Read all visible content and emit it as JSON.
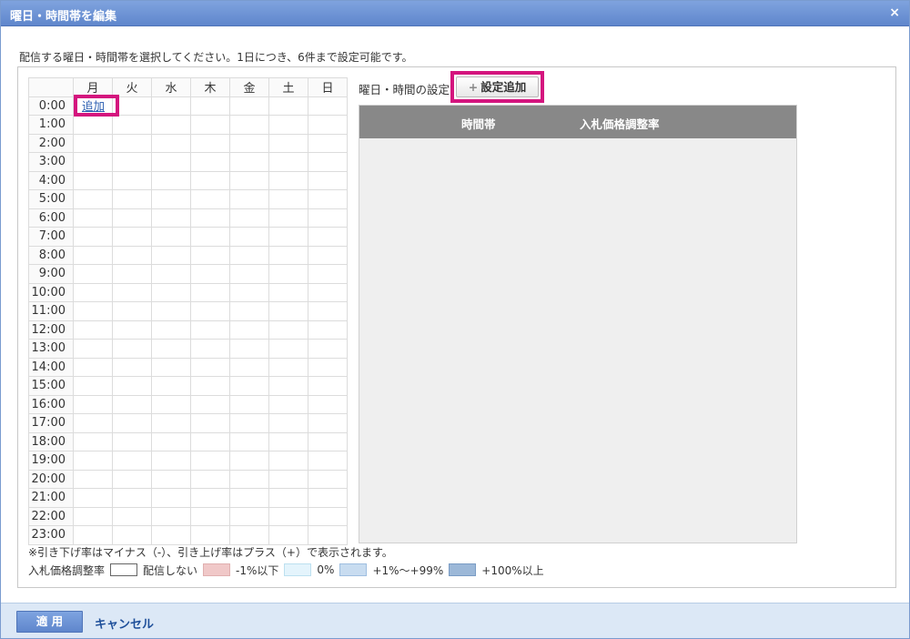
{
  "dialog": {
    "title": "曜日・時間帯を編集",
    "close_label": "×",
    "description": "配信する曜日・時間帯を選択してください。1日につき、6件まで設定可能です。"
  },
  "grid": {
    "days": [
      "月",
      "火",
      "水",
      "木",
      "金",
      "土",
      "日"
    ],
    "hours": [
      "0:00",
      "1:00",
      "2:00",
      "3:00",
      "4:00",
      "5:00",
      "6:00",
      "7:00",
      "8:00",
      "9:00",
      "10:00",
      "11:00",
      "12:00",
      "13:00",
      "14:00",
      "15:00",
      "16:00",
      "17:00",
      "18:00",
      "19:00",
      "20:00",
      "21:00",
      "22:00",
      "23:00"
    ],
    "add_link": "追加"
  },
  "settings": {
    "label": "曜日・時間の設定",
    "add_button": "設定追加",
    "columns": [
      "時間帯",
      "入札価格調整率"
    ]
  },
  "note": "※引き下げ率はマイナス（-）、引き上げ率はプラス（+）で表示されます。",
  "legend": {
    "title": "入札価格調整率",
    "items": [
      {
        "label": "配信しない",
        "color": "#ffffff"
      },
      {
        "label": "-1%以下",
        "color": "#f0c8c8"
      },
      {
        "label": "0%",
        "color": "#e4f4fc"
      },
      {
        "label": "+1%〜+99%",
        "color": "#c8dcf0"
      },
      {
        "label": "+100%以上",
        "color": "#9cb8d8"
      }
    ]
  },
  "footer": {
    "apply": "適 用",
    "cancel": "キャンセル"
  },
  "colors": {
    "titlebar": "#6a90d4",
    "highlight": "#d4157e",
    "footer": "#dce8f6"
  }
}
